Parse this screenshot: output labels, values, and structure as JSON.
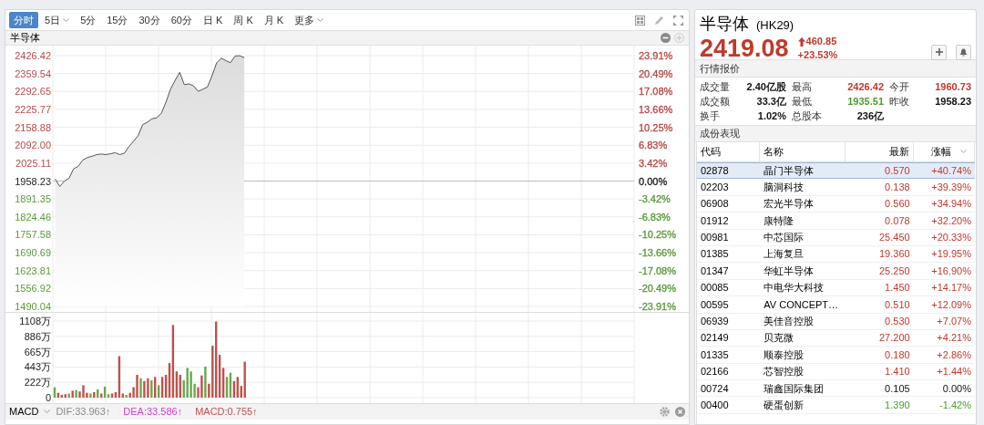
{
  "toolbar": {
    "tabs": [
      {
        "label": "分时",
        "selected": true,
        "dropdown": false
      },
      {
        "label": "5日",
        "selected": false,
        "dropdown": true
      },
      {
        "label": "5分",
        "selected": false,
        "dropdown": false
      },
      {
        "label": "15分",
        "selected": false,
        "dropdown": false
      },
      {
        "label": "30分",
        "selected": false,
        "dropdown": false
      },
      {
        "label": "60分",
        "selected": false,
        "dropdown": false
      },
      {
        "label": "日 K",
        "selected": false,
        "dropdown": false
      },
      {
        "label": "周 K",
        "selected": false,
        "dropdown": false
      },
      {
        "label": "月 K",
        "selected": false,
        "dropdown": false
      },
      {
        "label": "更多",
        "selected": false,
        "dropdown": true
      }
    ]
  },
  "chart_title": "半导体",
  "price_chart": {
    "chart_data": {
      "type": "area",
      "ylim": [
        1490.04,
        2426.42
      ],
      "categories": [
        null,
        null,
        null,
        null,
        null,
        null,
        null,
        null,
        null,
        null,
        null,
        null,
        null,
        null,
        null,
        null,
        null,
        null,
        null,
        null,
        null,
        null,
        null,
        null,
        null,
        null,
        null,
        null,
        null,
        null,
        null,
        null,
        null,
        null,
        null,
        null,
        null,
        null,
        null,
        null,
        null,
        null,
        null,
        null,
        null,
        null,
        null,
        null,
        null,
        null,
        null,
        null,
        null,
        null,
        null,
        null,
        null,
        null,
        null,
        null,
        null,
        null,
        null,
        null,
        null,
        null,
        null,
        null,
        null,
        null,
        null,
        null,
        null,
        null,
        null,
        null,
        null,
        null,
        null,
        null,
        null,
        null,
        null,
        null,
        null,
        null,
        null,
        null,
        null,
        null,
        null,
        null,
        null,
        null,
        null,
        null,
        null,
        null,
        null,
        null,
        null,
        null,
        null,
        null,
        null,
        null,
        null,
        null,
        null,
        null,
        null,
        null,
        null,
        null,
        null,
        null,
        null,
        null,
        null,
        null,
        null,
        null,
        null,
        null,
        null,
        null
      ],
      "grid": true,
      "ref_lines": [
        {
          "axis": "y",
          "value": 1958.23,
          "color": "#bdbdbd"
        }
      ],
      "series": [
        {
          "color": "#555555",
          "values": [
            1966,
            1938,
            1958,
            1968,
            2004,
            2013,
            2037,
            2046,
            2051,
            2057,
            2059,
            2057,
            2060,
            2064,
            2057,
            2062,
            2087,
            2107,
            2128,
            2169,
            2178,
            2191,
            2194,
            2211,
            2252,
            2301,
            2334,
            2364,
            2318,
            2321,
            2314,
            2293,
            2301,
            2309,
            2351,
            2400,
            2417,
            2408,
            2400,
            2425,
            2426,
            2419,
            null,
            null,
            null,
            null,
            null,
            null,
            null,
            null,
            null,
            null,
            null,
            null,
            null,
            null,
            null,
            null,
            null,
            null,
            null,
            null,
            null,
            null,
            null,
            null,
            null,
            null,
            null,
            null,
            null,
            null,
            null,
            null,
            null,
            null,
            null,
            null,
            null,
            null,
            null,
            null,
            null,
            null,
            null,
            null,
            null,
            null,
            null,
            null,
            null,
            null,
            null,
            null,
            null,
            null,
            null,
            null,
            null,
            null,
            null,
            null,
            null,
            null,
            null,
            null,
            null,
            null,
            null,
            null,
            null,
            null,
            null,
            null,
            null,
            null,
            null,
            null,
            null,
            null,
            null,
            null,
            null,
            null,
            null,
            null
          ]
        }
      ],
      "yticks": [
        {
          "value": 2426.42,
          "label": "2426.42"
        },
        {
          "value": 2359.54,
          "label": "2359.54"
        },
        {
          "value": 2292.65,
          "label": "2292.65"
        },
        {
          "value": 2225.77,
          "label": "2225.77"
        },
        {
          "value": 2158.88,
          "label": "2158.88"
        },
        {
          "value": 2092.0,
          "label": "2092.00"
        },
        {
          "value": 2025.11,
          "label": "2025.11"
        },
        {
          "value": 1958.23,
          "label": "1958.23"
        },
        {
          "value": 1891.35,
          "label": "1891.35"
        },
        {
          "value": 1824.46,
          "label": "1824.46"
        },
        {
          "value": 1757.58,
          "label": "1757.58"
        },
        {
          "value": 1690.69,
          "label": "1690.69"
        },
        {
          "value": 1623.81,
          "label": "1623.81"
        },
        {
          "value": 1556.92,
          "label": "1556.92"
        },
        {
          "value": 1490.04,
          "label": "1490.04"
        }
      ]
    },
    "right_labels": [
      {
        "label": "23.91%",
        "color": "#b84a48"
      },
      {
        "label": "20.49%",
        "color": "#b84a48"
      },
      {
        "label": "17.08%",
        "color": "#b84a48"
      },
      {
        "label": "13.66%",
        "color": "#b84a48"
      },
      {
        "label": "10.25%",
        "color": "#b84a48"
      },
      {
        "label": "6.83%",
        "color": "#b84a48"
      },
      {
        "label": "3.42%",
        "color": "#b84a48"
      },
      {
        "label": "0.00%",
        "color": "#222222"
      },
      {
        "label": "-3.42%",
        "color": "#5a9a3a"
      },
      {
        "label": "-6.83%",
        "color": "#5a9a3a"
      },
      {
        "label": "-10.25%",
        "color": "#5a9a3a"
      },
      {
        "label": "-13.66%",
        "color": "#5a9a3a"
      },
      {
        "label": "-17.08%",
        "color": "#5a9a3a"
      },
      {
        "label": "-20.49%",
        "color": "#5a9a3a"
      },
      {
        "label": "-23.91%",
        "color": "#5a9a3a"
      }
    ]
  },
  "volume_chart": {
    "chart_data": {
      "type": "bar",
      "ylim": [
        0,
        1108
      ],
      "grid": true,
      "categories": [
        null,
        null,
        null,
        null,
        null,
        null,
        null,
        null,
        null,
        null,
        null,
        null,
        null,
        null,
        null,
        null,
        null,
        null,
        null,
        null,
        null,
        null,
        null,
        null,
        null,
        null,
        null,
        null,
        null,
        null,
        null,
        null,
        null,
        null,
        null,
        null,
        null,
        null,
        null,
        null,
        null,
        null,
        null,
        null,
        null,
        null,
        null,
        null,
        null,
        null,
        null,
        null,
        null,
        null,
        null,
        null,
        null,
        null,
        null,
        null,
        null,
        null,
        null,
        null,
        null,
        null,
        null,
        null,
        null,
        null,
        null,
        null,
        null,
        null,
        null,
        null,
        null,
        null,
        null,
        null,
        null,
        null,
        null,
        null,
        null,
        null,
        null,
        null,
        null,
        null,
        null,
        null,
        null,
        null,
        null,
        null,
        null,
        null,
        null,
        null,
        null,
        null,
        null,
        null,
        null,
        null,
        null,
        null,
        null,
        null,
        null,
        null,
        null,
        null,
        null,
        null,
        null,
        null,
        null,
        null,
        null,
        null,
        null,
        null,
        null,
        null,
        null,
        null,
        null,
        null,
        null,
        null,
        null,
        null,
        null,
        null,
        null,
        null,
        null,
        null,
        null,
        null,
        null,
        null,
        null,
        null,
        null,
        null,
        null,
        null,
        null,
        null,
        null,
        null,
        null,
        null,
        null,
        null,
        null,
        null,
        null,
        null
      ],
      "series": [
        {
          "color": "#c0504d",
          "values": [
            null,
            70,
            40,
            50,
            null,
            100,
            null,
            90,
            180,
            70,
            null,
            80,
            null,
            60,
            null,
            null,
            60,
            80,
            600,
            60,
            null,
            70,
            150,
            330,
            null,
            240,
            280,
            null,
            300,
            null,
            300,
            330,
            500,
            1050,
            380,
            330,
            null,
            null,
            null,
            null,
            150,
            320,
            null,
            200,
            750,
            1100,
            620,
            430,
            null,
            null,
            240,
            300,
            170,
            520,
            null,
            null,
            null,
            null,
            null,
            null,
            null,
            null,
            null,
            null,
            null,
            null,
            null,
            null,
            null,
            null,
            null,
            null,
            null,
            null,
            null,
            null,
            null,
            null,
            null,
            null,
            null,
            null,
            null,
            null,
            null,
            null,
            null,
            null,
            null,
            null,
            null,
            null,
            null,
            null,
            null,
            null,
            null,
            null,
            null,
            null,
            null,
            null,
            null,
            null,
            null,
            null,
            null,
            null,
            null,
            null,
            null,
            null,
            null,
            null,
            null,
            null,
            null,
            null,
            null,
            null,
            null,
            null,
            null,
            null,
            null,
            null,
            null,
            null,
            null,
            null,
            null,
            null,
            null,
            null,
            null,
            null,
            null,
            null,
            null,
            null,
            null,
            null,
            null,
            null,
            null,
            null,
            null,
            null,
            null,
            null,
            null,
            null,
            null,
            null,
            null,
            null,
            null,
            null,
            null,
            null,
            null,
            null
          ]
        },
        {
          "color": "#6aa84f",
          "values": [
            150,
            null,
            null,
            null,
            60,
            null,
            110,
            null,
            null,
            null,
            60,
            null,
            120,
            null,
            160,
            50,
            null,
            null,
            null,
            null,
            40,
            null,
            null,
            null,
            280,
            null,
            null,
            250,
            null,
            180,
            null,
            null,
            null,
            null,
            null,
            null,
            250,
            430,
            380,
            200,
            null,
            null,
            450,
            null,
            null,
            null,
            null,
            null,
            300,
            360,
            null,
            null,
            null,
            null,
            null,
            null,
            null,
            null,
            null,
            null,
            null,
            null,
            null,
            null,
            null,
            null,
            null,
            null,
            null,
            null,
            null,
            null,
            null,
            null,
            null,
            null,
            null,
            null,
            null,
            null,
            null,
            null,
            null,
            null,
            null,
            null,
            null,
            null,
            null,
            null,
            null,
            null,
            null,
            null,
            null,
            null,
            null,
            null,
            null,
            null,
            null,
            null,
            null,
            null,
            null,
            null,
            null,
            null,
            null,
            null,
            null,
            null,
            null,
            null,
            null,
            null,
            null,
            null,
            null,
            null,
            null,
            null,
            null,
            null,
            null,
            null,
            null,
            null,
            null,
            null,
            null,
            null,
            null,
            null,
            null,
            null,
            null,
            null,
            null,
            null,
            null,
            null,
            null,
            null,
            null,
            null,
            null,
            null,
            null,
            null,
            null,
            null,
            null,
            null,
            null,
            null,
            null,
            null,
            null,
            null,
            null,
            null
          ]
        }
      ],
      "yticks": [
        {
          "value": 1108,
          "label": "1108万"
        },
        {
          "value": 886,
          "label": "886万"
        },
        {
          "value": 665,
          "label": "665万"
        },
        {
          "value": 443,
          "label": "443万"
        },
        {
          "value": 222,
          "label": "222万"
        },
        {
          "value": 0,
          "label": "0"
        }
      ]
    }
  },
  "indicator_bar": {
    "name": "MACD",
    "readings": [
      {
        "label": "DIF:33.963↑",
        "color": "#8a8a8a"
      },
      {
        "label": "DEA:33.586↑",
        "color": "#d63ad6"
      },
      {
        "label": "MACD:0.755↑",
        "color": "#c0504d"
      }
    ]
  },
  "quote": {
    "name": "半导体",
    "code": "(HK29)",
    "price": "2419.08",
    "change": "460.85",
    "change_pct": "+23.53%",
    "color": "#c0392b"
  },
  "section_quote": "行情报价",
  "stats": [
    {
      "label": "成交量",
      "value": "2.40亿股",
      "color": "#111111"
    },
    {
      "label": "最高",
      "value": "2426.42",
      "color": "#c0392b"
    },
    {
      "label": "今开",
      "value": "1960.73",
      "color": "#c0392b"
    },
    {
      "label": "成交额",
      "value": "33.3亿",
      "color": "#111111"
    },
    {
      "label": "最低",
      "value": "1935.51",
      "color": "#4e9a2e"
    },
    {
      "label": "昨收",
      "value": "1958.23",
      "color": "#111111"
    },
    {
      "label": "换手",
      "value": "1.02%",
      "color": "#111111"
    },
    {
      "label": "总股本",
      "value": "236亿",
      "color": "#111111"
    }
  ],
  "section_components": "成份表现",
  "table": {
    "columns": [
      {
        "label": "代码",
        "sorted": false
      },
      {
        "label": "名称",
        "sorted": false
      },
      {
        "label": "最新",
        "sorted": false
      },
      {
        "label": "涨幅",
        "sorted": true
      }
    ],
    "rows": [
      {
        "code": "02878",
        "name": "晶门半导体",
        "price": "0.570",
        "change": "+40.74%",
        "color": "#c0392b",
        "selected": true
      },
      {
        "code": "02203",
        "name": "脑洞科技",
        "price": "0.138",
        "change": "+39.39%",
        "color": "#c0392b",
        "selected": false
      },
      {
        "code": "06908",
        "name": "宏光半导体",
        "price": "0.560",
        "change": "+34.94%",
        "color": "#c0392b",
        "selected": false
      },
      {
        "code": "01912",
        "name": "康特隆",
        "price": "0.078",
        "change": "+32.20%",
        "color": "#c0392b",
        "selected": false
      },
      {
        "code": "00981",
        "name": "中芯国际",
        "price": "25.450",
        "change": "+20.33%",
        "color": "#c0392b",
        "selected": false
      },
      {
        "code": "01385",
        "name": "上海复旦",
        "price": "19.360",
        "change": "+19.95%",
        "color": "#c0392b",
        "selected": false
      },
      {
        "code": "01347",
        "name": "华虹半导体",
        "price": "25.250",
        "change": "+16.90%",
        "color": "#c0392b",
        "selected": false
      },
      {
        "code": "00085",
        "name": "中电华大科技",
        "price": "1.450",
        "change": "+14.17%",
        "color": "#c0392b",
        "selected": false
      },
      {
        "code": "00595",
        "name": "AV CONCEPT…",
        "price": "0.510",
        "change": "+12.09%",
        "color": "#c0392b",
        "selected": false
      },
      {
        "code": "06939",
        "name": "美佳音控股",
        "price": "0.530",
        "change": "+7.07%",
        "color": "#c0392b",
        "selected": false
      },
      {
        "code": "02149",
        "name": "贝克微",
        "price": "27.200",
        "change": "+4.21%",
        "color": "#c0392b",
        "selected": false
      },
      {
        "code": "01335",
        "name": "顺泰控股",
        "price": "0.180",
        "change": "+2.86%",
        "color": "#c0392b",
        "selected": false
      },
      {
        "code": "02166",
        "name": "芯智控股",
        "price": "1.410",
        "change": "+1.44%",
        "color": "#c0392b",
        "selected": false
      },
      {
        "code": "00724",
        "name": "瑞鑫国际集团",
        "price": "0.105",
        "change": "0.00%",
        "color": "#111111",
        "selected": false
      },
      {
        "code": "00400",
        "name": "硬蛋创新",
        "price": "1.390",
        "change": "-1.42%",
        "color": "#4e9a2e",
        "selected": false
      }
    ]
  }
}
